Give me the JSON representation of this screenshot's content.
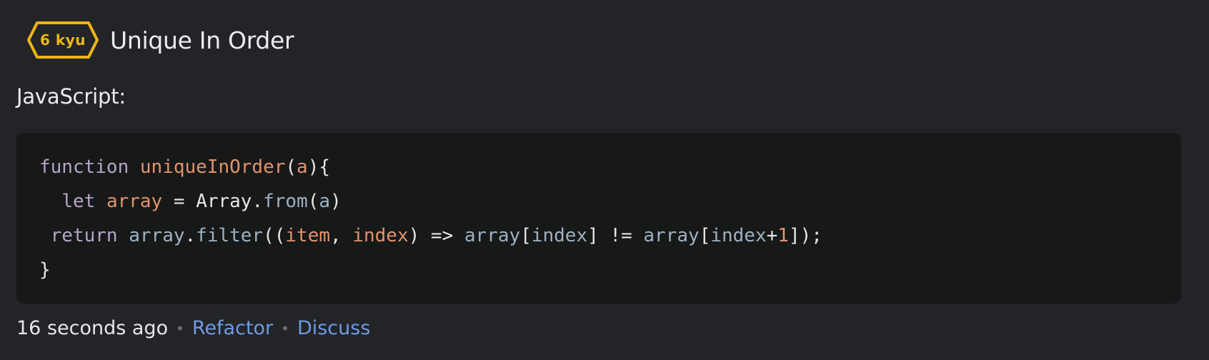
{
  "kata": {
    "rank": "6 kyu",
    "rank_color": "#ecb613",
    "title": "Unique In Order"
  },
  "language": {
    "label": "JavaScript:"
  },
  "code": {
    "lines": [
      [
        {
          "t": "function",
          "c": "kw"
        },
        {
          "t": " ",
          "c": "plain"
        },
        {
          "t": "uniqueInOrder",
          "c": "fn"
        },
        {
          "t": "(",
          "c": "punc"
        },
        {
          "t": "a",
          "c": "var"
        },
        {
          "t": "){",
          "c": "punc"
        }
      ],
      [
        {
          "t": "  ",
          "c": "plain"
        },
        {
          "t": "let",
          "c": "kw"
        },
        {
          "t": " ",
          "c": "plain"
        },
        {
          "t": "array",
          "c": "var"
        },
        {
          "t": " = ",
          "c": "plain"
        },
        {
          "t": "Array",
          "c": "plain"
        },
        {
          "t": ".",
          "c": "punc"
        },
        {
          "t": "from",
          "c": "id"
        },
        {
          "t": "(",
          "c": "punc"
        },
        {
          "t": "a",
          "c": "id"
        },
        {
          "t": ")",
          "c": "punc"
        }
      ],
      [
        {
          "t": " ",
          "c": "plain"
        },
        {
          "t": "return",
          "c": "kw"
        },
        {
          "t": " ",
          "c": "plain"
        },
        {
          "t": "array",
          "c": "id"
        },
        {
          "t": ".",
          "c": "punc"
        },
        {
          "t": "filter",
          "c": "id"
        },
        {
          "t": "((",
          "c": "punc"
        },
        {
          "t": "item",
          "c": "var"
        },
        {
          "t": ", ",
          "c": "punc"
        },
        {
          "t": "index",
          "c": "var"
        },
        {
          "t": ") => ",
          "c": "punc"
        },
        {
          "t": "array",
          "c": "id"
        },
        {
          "t": "[",
          "c": "punc"
        },
        {
          "t": "index",
          "c": "id"
        },
        {
          "t": "] != ",
          "c": "punc"
        },
        {
          "t": "array",
          "c": "id"
        },
        {
          "t": "[",
          "c": "punc"
        },
        {
          "t": "index",
          "c": "id"
        },
        {
          "t": "+",
          "c": "punc"
        },
        {
          "t": "1",
          "c": "num"
        },
        {
          "t": "]);",
          "c": "punc"
        }
      ],
      [
        {
          "t": "}",
          "c": "punc"
        }
      ]
    ]
  },
  "footer": {
    "timestamp": "16 seconds ago",
    "separator": "•",
    "refactor_label": "Refactor",
    "discuss_label": "Discuss",
    "link_color": "#6f9be0"
  }
}
